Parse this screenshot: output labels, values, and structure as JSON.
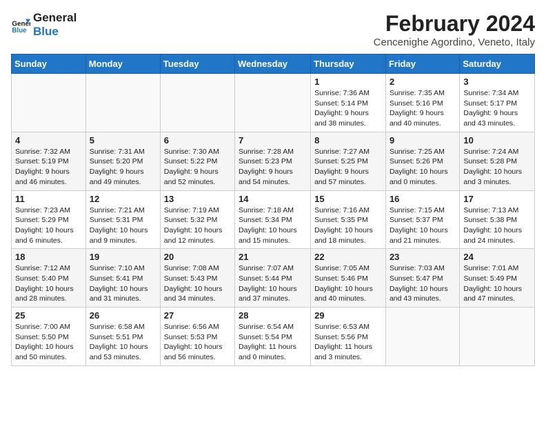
{
  "header": {
    "logo_line1": "General",
    "logo_line2": "Blue",
    "month_title": "February 2024",
    "location": "Cencenighe Agordino, Veneto, Italy"
  },
  "weekdays": [
    "Sunday",
    "Monday",
    "Tuesday",
    "Wednesday",
    "Thursday",
    "Friday",
    "Saturday"
  ],
  "weeks": [
    [
      {
        "day": "",
        "info": ""
      },
      {
        "day": "",
        "info": ""
      },
      {
        "day": "",
        "info": ""
      },
      {
        "day": "",
        "info": ""
      },
      {
        "day": "1",
        "info": "Sunrise: 7:36 AM\nSunset: 5:14 PM\nDaylight: 9 hours\nand 38 minutes."
      },
      {
        "day": "2",
        "info": "Sunrise: 7:35 AM\nSunset: 5:16 PM\nDaylight: 9 hours\nand 40 minutes."
      },
      {
        "day": "3",
        "info": "Sunrise: 7:34 AM\nSunset: 5:17 PM\nDaylight: 9 hours\nand 43 minutes."
      }
    ],
    [
      {
        "day": "4",
        "info": "Sunrise: 7:32 AM\nSunset: 5:19 PM\nDaylight: 9 hours\nand 46 minutes."
      },
      {
        "day": "5",
        "info": "Sunrise: 7:31 AM\nSunset: 5:20 PM\nDaylight: 9 hours\nand 49 minutes."
      },
      {
        "day": "6",
        "info": "Sunrise: 7:30 AM\nSunset: 5:22 PM\nDaylight: 9 hours\nand 52 minutes."
      },
      {
        "day": "7",
        "info": "Sunrise: 7:28 AM\nSunset: 5:23 PM\nDaylight: 9 hours\nand 54 minutes."
      },
      {
        "day": "8",
        "info": "Sunrise: 7:27 AM\nSunset: 5:25 PM\nDaylight: 9 hours\nand 57 minutes."
      },
      {
        "day": "9",
        "info": "Sunrise: 7:25 AM\nSunset: 5:26 PM\nDaylight: 10 hours\nand 0 minutes."
      },
      {
        "day": "10",
        "info": "Sunrise: 7:24 AM\nSunset: 5:28 PM\nDaylight: 10 hours\nand 3 minutes."
      }
    ],
    [
      {
        "day": "11",
        "info": "Sunrise: 7:23 AM\nSunset: 5:29 PM\nDaylight: 10 hours\nand 6 minutes."
      },
      {
        "day": "12",
        "info": "Sunrise: 7:21 AM\nSunset: 5:31 PM\nDaylight: 10 hours\nand 9 minutes."
      },
      {
        "day": "13",
        "info": "Sunrise: 7:19 AM\nSunset: 5:32 PM\nDaylight: 10 hours\nand 12 minutes."
      },
      {
        "day": "14",
        "info": "Sunrise: 7:18 AM\nSunset: 5:34 PM\nDaylight: 10 hours\nand 15 minutes."
      },
      {
        "day": "15",
        "info": "Sunrise: 7:16 AM\nSunset: 5:35 PM\nDaylight: 10 hours\nand 18 minutes."
      },
      {
        "day": "16",
        "info": "Sunrise: 7:15 AM\nSunset: 5:37 PM\nDaylight: 10 hours\nand 21 minutes."
      },
      {
        "day": "17",
        "info": "Sunrise: 7:13 AM\nSunset: 5:38 PM\nDaylight: 10 hours\nand 24 minutes."
      }
    ],
    [
      {
        "day": "18",
        "info": "Sunrise: 7:12 AM\nSunset: 5:40 PM\nDaylight: 10 hours\nand 28 minutes."
      },
      {
        "day": "19",
        "info": "Sunrise: 7:10 AM\nSunset: 5:41 PM\nDaylight: 10 hours\nand 31 minutes."
      },
      {
        "day": "20",
        "info": "Sunrise: 7:08 AM\nSunset: 5:43 PM\nDaylight: 10 hours\nand 34 minutes."
      },
      {
        "day": "21",
        "info": "Sunrise: 7:07 AM\nSunset: 5:44 PM\nDaylight: 10 hours\nand 37 minutes."
      },
      {
        "day": "22",
        "info": "Sunrise: 7:05 AM\nSunset: 5:46 PM\nDaylight: 10 hours\nand 40 minutes."
      },
      {
        "day": "23",
        "info": "Sunrise: 7:03 AM\nSunset: 5:47 PM\nDaylight: 10 hours\nand 43 minutes."
      },
      {
        "day": "24",
        "info": "Sunrise: 7:01 AM\nSunset: 5:49 PM\nDaylight: 10 hours\nand 47 minutes."
      }
    ],
    [
      {
        "day": "25",
        "info": "Sunrise: 7:00 AM\nSunset: 5:50 PM\nDaylight: 10 hours\nand 50 minutes."
      },
      {
        "day": "26",
        "info": "Sunrise: 6:58 AM\nSunset: 5:51 PM\nDaylight: 10 hours\nand 53 minutes."
      },
      {
        "day": "27",
        "info": "Sunrise: 6:56 AM\nSunset: 5:53 PM\nDaylight: 10 hours\nand 56 minutes."
      },
      {
        "day": "28",
        "info": "Sunrise: 6:54 AM\nSunset: 5:54 PM\nDaylight: 11 hours\nand 0 minutes."
      },
      {
        "day": "29",
        "info": "Sunrise: 6:53 AM\nSunset: 5:56 PM\nDaylight: 11 hours\nand 3 minutes."
      },
      {
        "day": "",
        "info": ""
      },
      {
        "day": "",
        "info": ""
      }
    ]
  ]
}
